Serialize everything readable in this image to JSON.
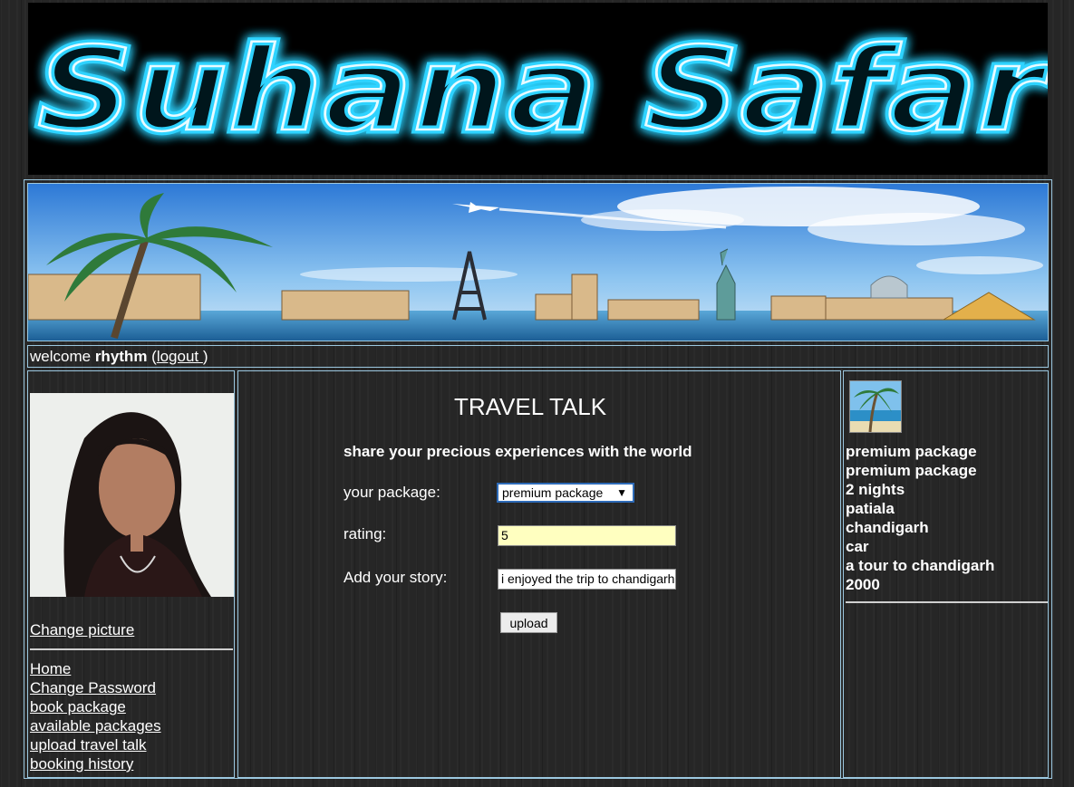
{
  "logo": {
    "text": "Suhana Safar"
  },
  "welcome": {
    "prefix": "welcome ",
    "username": "rhythm",
    "open_paren": " (",
    "logout_label": "logout ",
    "close_paren": ")"
  },
  "sidebar": {
    "change_picture": "Change picture",
    "items": [
      {
        "label": "Home "
      },
      {
        "label": "Change Password"
      },
      {
        "label": "book package "
      },
      {
        "label": "available packages"
      },
      {
        "label": "upload travel talk"
      },
      {
        "label": "booking history"
      }
    ]
  },
  "main": {
    "title": "TRAVEL TALK",
    "subtitle": "share your precious experiences with the world",
    "package_label": "your package:",
    "package_value": "premium package",
    "rating_label": "rating:",
    "rating_value": "5",
    "story_label": "Add your story:",
    "story_value": "i enjoyed the trip to chandigarh",
    "upload_label": "upload"
  },
  "package_info": {
    "lines": [
      "premium package",
      "premium package",
      "2 nights",
      "patiala",
      "chandigarh",
      "car",
      "a tour to chandigarh",
      "2000"
    ]
  },
  "colors": {
    "neon_glow": "#2fd3ff",
    "border": "#9cc8e0",
    "rating_bg": "#ffffc0"
  }
}
